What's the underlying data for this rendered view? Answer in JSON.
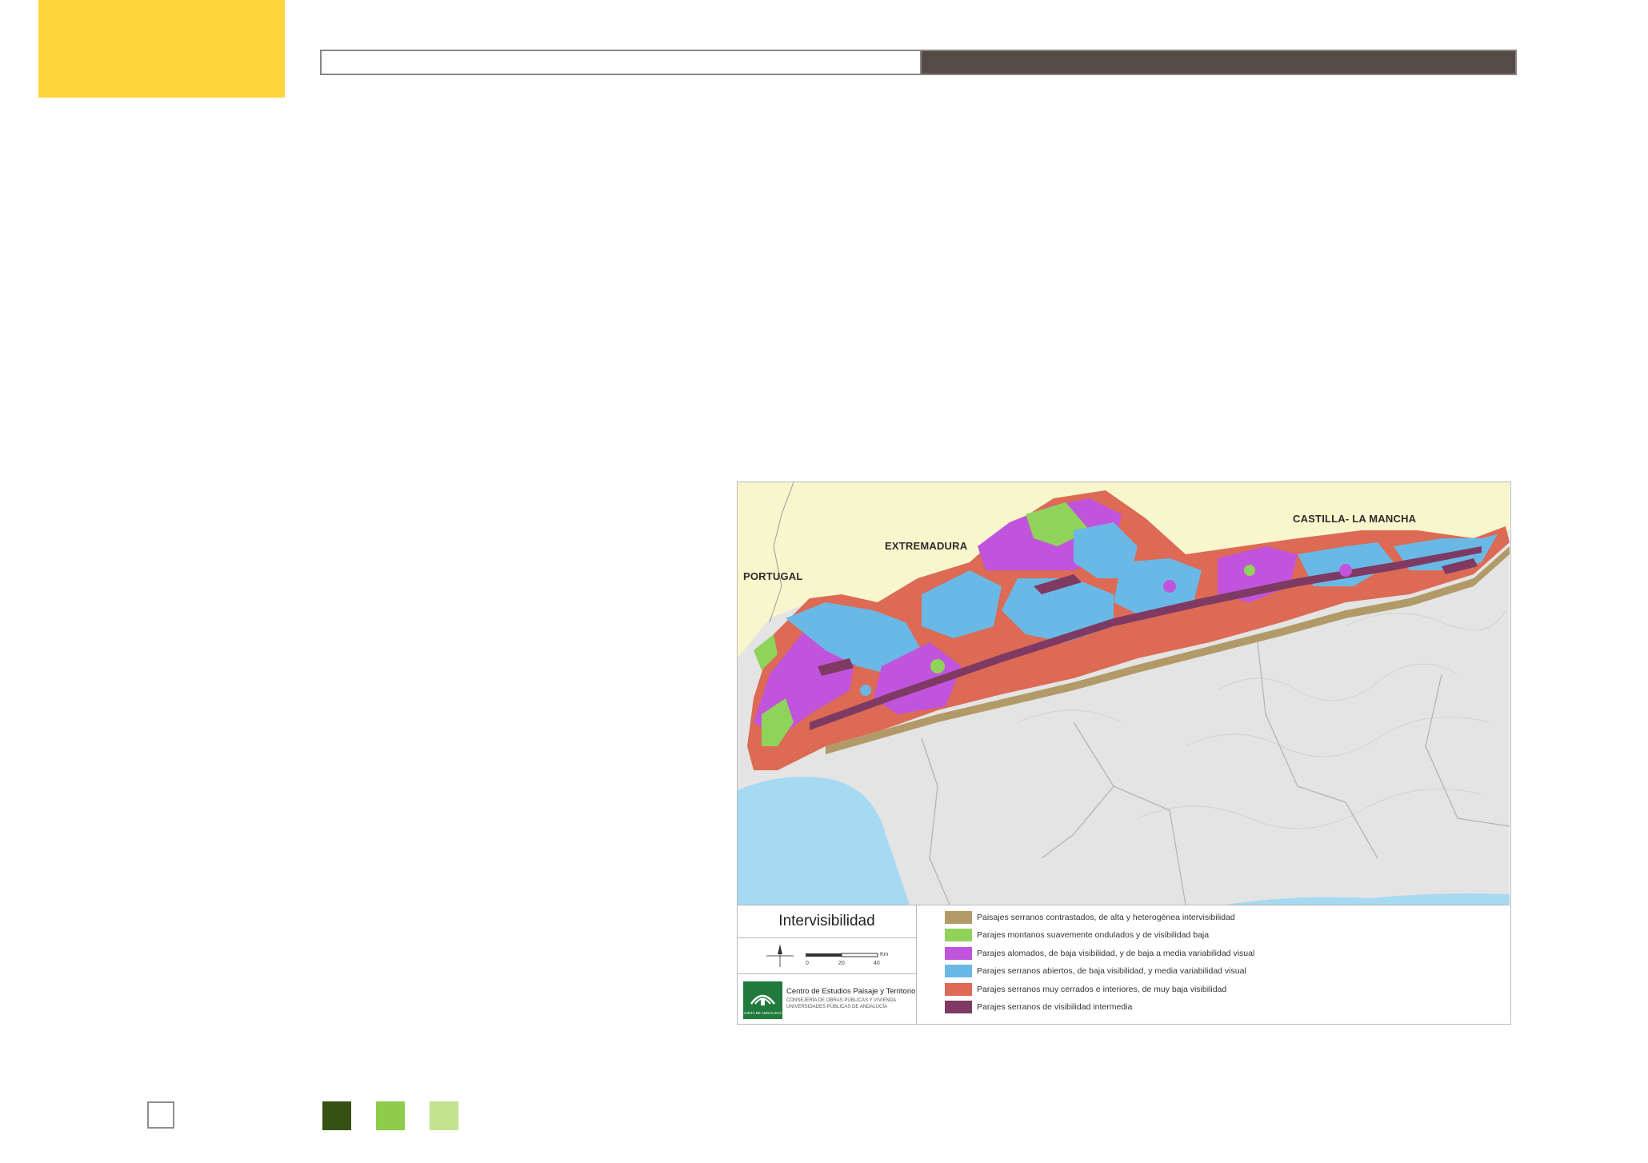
{
  "colors": {
    "accent_yellow": "#FED53A",
    "header_dark": "#544B47",
    "footer_squares": [
      "#375114",
      "#8FCC4A",
      "#C2E28F"
    ]
  },
  "map": {
    "region_labels": {
      "portugal": "PORTUGAL",
      "extremadura": "EXTREMADURA",
      "castilla": "CASTILLA- LA MANCHA"
    },
    "colors": {
      "outside_land": "#F8F6CC",
      "andalucia_relief": "#E4E4E4",
      "sea": "#A6D9F2"
    }
  },
  "legend": {
    "title": "Intervisibilidad",
    "scale": {
      "unit": "Km",
      "ticks": [
        "0",
        "20",
        "40"
      ]
    },
    "institution": {
      "logo_text": "JUNTA DE ANDALUCIA",
      "name": "Centro de Estudios Paisaje y Territorio",
      "sub_line_1": "CONSEJERÍA DE OBRAS PÚBLICAS Y VIVIENDA",
      "sub_line_2": "UNIVERSIDADES PÚBLICAS DE ANDALUCÍA"
    },
    "items": [
      {
        "label": "Paisajes serranos contrastados, de alta y heterogénea intervisibilidad",
        "color": "#B29A68"
      },
      {
        "label": "Parajes montanos suavemente ondulados y de visibilidad baja",
        "color": "#8FD35A"
      },
      {
        "label": "Parajes alomados, de baja visibilidad, y de baja a media variabilidad visual",
        "color": "#C154DC"
      },
      {
        "label": "Parajes serranos abiertos, de baja visibilidad, y media variabilidad visual",
        "color": "#6AB8E6"
      },
      {
        "label": "Parajes serranos muy cerrados e interiores, de muy baja visibilidad",
        "color": "#DC6A54"
      },
      {
        "label": "Parajes serranos de visibilidad intermedia",
        "color": "#7E3A62"
      }
    ]
  }
}
